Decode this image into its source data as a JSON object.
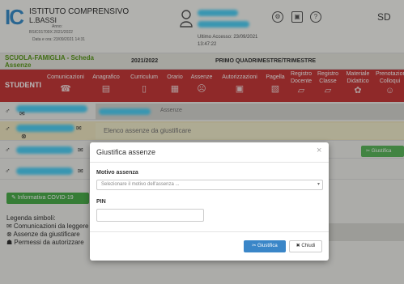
{
  "header": {
    "logo": "IC",
    "school_name": "ISTITUTO COMPRENSIVO",
    "school_sub": "L.BASSI",
    "small_1": "Anno:",
    "small_2": "BSIC01700X 2021/2022",
    "small_3": "Data e ora: 23/09/2021 14:31",
    "last_access_label": "Ultimo Accesso: 23/09/2021",
    "last_access_time": "13:47:22",
    "brand": "SD"
  },
  "scheda": {
    "title": "SCUOLA-FAMIGLIA - Scheda",
    "subtitle": "Assenze",
    "year": "2021/2022",
    "period": "PRIMO QUADRIMESTRE/TRIMESTRE"
  },
  "nav": {
    "studenti": "STUDENTI",
    "items": [
      {
        "label": "Comunicazioni",
        "icon": "☎"
      },
      {
        "label": "Anagrafico",
        "icon": "▤"
      },
      {
        "label": "Curriculum",
        "icon": "▯"
      },
      {
        "label": "Orario",
        "icon": "▦"
      },
      {
        "label": "Assenze",
        "icon": "☹"
      },
      {
        "label": "Autorizzazioni",
        "icon": "▣"
      },
      {
        "label": "Pagella",
        "icon": "▧"
      },
      {
        "label": "Registro Docente",
        "icon": "▱"
      },
      {
        "label": "Registro Classe",
        "icon": "▱"
      },
      {
        "label": "Materiale Didattico",
        "icon": "✿"
      },
      {
        "label": "Prenotazione Colloqui",
        "icon": "☺"
      }
    ]
  },
  "rows": {
    "assenze_text": "Assenze",
    "elenco_text": "Elenco assenze da giustificare",
    "giustifica_green": "✂ Giustifica",
    "covid_button": "✎ Informativa COVID-19"
  },
  "legend": {
    "title": "Legenda simboli:",
    "l1": "✉ Comunicazioni da leggere",
    "l2": "⊗ Assenze da giustificare",
    "l3": "☗ Permessi da autorizzare"
  },
  "modal": {
    "title": "Giustifica assenze",
    "close": "×",
    "motivo_label": "Motivo assenza",
    "motivo_placeholder": "Selezionare il motivo dell'assenza ...",
    "pin_label": "PIN",
    "giustifica_button": "✂ Giustifica",
    "chiudi_button": "✖ Chiudi"
  }
}
